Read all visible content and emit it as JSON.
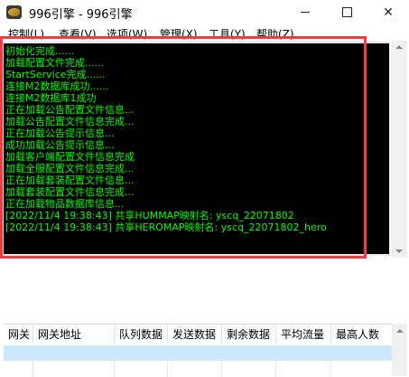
{
  "window": {
    "title": "996引擎 - 996引擎"
  },
  "menu": [
    {
      "label": "控制(L)"
    },
    {
      "label": "查看(V)"
    },
    {
      "label": "选项(W)"
    },
    {
      "label": "管理(X)"
    },
    {
      "label": "工具(Y)"
    },
    {
      "label": "帮助(Z)"
    }
  ],
  "log_lines": [
    "初始化完成......",
    "加载配置文件完成......",
    "StartService完成......",
    "连接M2数据库成功......",
    "连接M2数据库1成功",
    "正在加载公告配置文件信息...",
    "加载公告配置文件信息完成...",
    "正在加载公告提示信息...",
    "成功加载公告提示信息...",
    "加载客户端配置文件信息完成",
    "加载全服配置文件信息完成...",
    "正在加载套装配置文件信息...",
    "加载套装配置文件信息完成...",
    "正在加载物品数据库信息...",
    "[2022/11/4 19:38:43] 共享HUMMAP映射名: yscq_22071802",
    "[2022/11/4 19:38:43] 共享HEROMAP映射名: yscq_22071802_hero"
  ],
  "colors": {
    "log_text": "#00ff00",
    "console_bg": "#000000",
    "highlight_border": "#f03c3c",
    "selected_row": "#cce8ff"
  },
  "gateway_table": {
    "columns": [
      "网关",
      "网关地址",
      "队列数据",
      "发送数据",
      "剩余数据",
      "平均流量",
      "最高人数"
    ]
  }
}
